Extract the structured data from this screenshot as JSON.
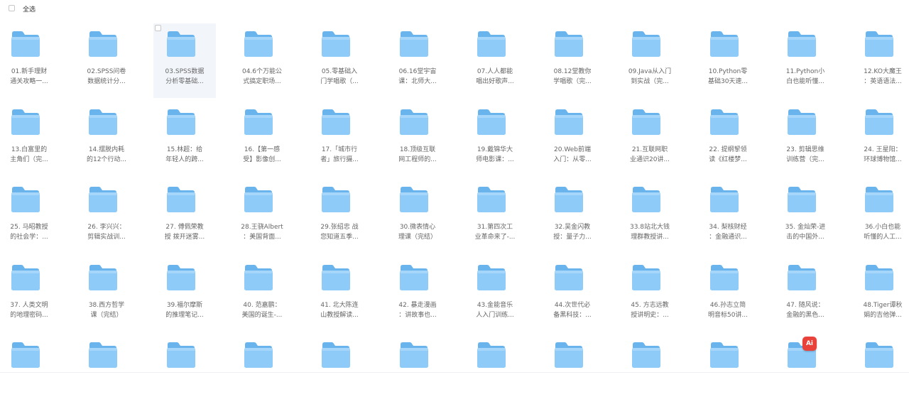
{
  "header": {
    "select_all_label": "全选"
  },
  "accent_color": "#7cc0f5",
  "ai_badge": {
    "icon": "ai-icon",
    "text": "Ai",
    "color": "#e8423a"
  },
  "folders": [
    {
      "name": "01.新手理财通关攻略一...",
      "line1": "01.新手理财",
      "line2": "通关攻略一..."
    },
    {
      "name": "02.SPSS问卷数据统计分...",
      "line1": "02.SPSS问卷",
      "line2": "数据统计分..."
    },
    {
      "name": "03.SPSS数据分析零基础...",
      "line1": "03.SPSS数据",
      "line2": "分析零基础..."
    },
    {
      "name": "04.6个万能公式搞定职场...",
      "line1": "04.6个万能公",
      "line2": "式搞定职场..."
    },
    {
      "name": "05.零基础入门学唱歌（...",
      "line1": "05.零基础入",
      "line2": "门学唱歌（..."
    },
    {
      "name": "06.16堂宇宙课：北师大...",
      "line1": "06.16堂宇宙",
      "line2": "课：北师大..."
    },
    {
      "name": "07.人人都能唱出好歌声...",
      "line1": "07.人人都能",
      "line2": "唱出好歌声..."
    },
    {
      "name": "08.12堂教你学唱歌（完...",
      "line1": "08.12堂教你",
      "line2": "学唱歌（完..."
    },
    {
      "name": "09.Java从入门到实战（完...",
      "line1": "09.Java从入门",
      "line2": "到实战（完..."
    },
    {
      "name": "10.Python零基础30天速...",
      "line1": "10.Python零",
      "line2": "基础30天速..."
    },
    {
      "name": "11.Python小白也能听懂...",
      "line1": "11.Python小",
      "line2": "白也能听懂..."
    },
    {
      "name": "12.KO大魔王：英语语法...",
      "line1": "12.KO大魔王",
      "line2": "：英语语法..."
    },
    {
      "name": "13.白富里的主角们（完...",
      "line1": "13.白富里的",
      "line2": "主角们（完..."
    },
    {
      "name": "14.摆脱内耗的12个行动...",
      "line1": "14.摆脱内耗",
      "line2": "的12个行动..."
    },
    {
      "name": "15.林超：给年轻人的跨...",
      "line1": "15.林超：给",
      "line2": "年轻人的跨..."
    },
    {
      "name": "16.【第一感受】影像创...",
      "line1": "16.【第一感",
      "line2": "受】影像创..."
    },
    {
      "name": "17.「城市行者」旅行摄...",
      "line1": "17.「城市行",
      "line2": "者」旅行摄..."
    },
    {
      "name": "18.顶级互联网工程师的...",
      "line1": "18.顶级互联",
      "line2": "网工程师的..."
    },
    {
      "name": "19.戴锦华大师电影课：...",
      "line1": "19.戴锦华大",
      "line2": "师电影课：..."
    },
    {
      "name": "20.Web前端入门：从零...",
      "line1": "20.Web前端",
      "line2": "入门：从零..."
    },
    {
      "name": "21.互联网职业通识20讲...",
      "line1": "21.互联网职",
      "line2": "业通识20讲..."
    },
    {
      "name": "22.提纲挈领读《红楼梦...",
      "line1": "22. 提纲挈领",
      "line2": "读《红楼梦..."
    },
    {
      "name": "23.剪辑思维训练营（完...",
      "line1": "23. 剪辑思维",
      "line2": "训练营（完..."
    },
    {
      "name": "24.王星阳：环球博物馆...",
      "line1": "24. 王星阳：",
      "line2": "环球博物馆..."
    },
    {
      "name": "25.马昭教授的社会学：...",
      "line1": "25. 马昭教授",
      "line2": "的社会学：..."
    },
    {
      "name": "26.李兴兴：剪辑实战训...",
      "line1": "26. 李兴兴：",
      "line2": "剪辑实战训..."
    },
    {
      "name": "27.傅佩荣教授 拨开迷雾...",
      "line1": "27. 傅佩荣教",
      "line2": "授 拨开迷雾..."
    },
    {
      "name": "28.王骁Albert：美国背面...",
      "line1": "28.王骁Albert",
      "line2": "：美国背面..."
    },
    {
      "name": "29.张绍忠 战您知道五季...",
      "line1": "29.张绍忠 战",
      "line2": "您知道五季..."
    },
    {
      "name": "30.微表情心理课（完结）",
      "line1": "30.微表情心",
      "line2": "理课（完结）"
    },
    {
      "name": "31.第四次工业革命来了-...",
      "line1": "31.第四次工",
      "line2": "业革命来了-..."
    },
    {
      "name": "32.吴金闪教授：量子力...",
      "line1": "32.吴金闪教",
      "line2": "授：量子力..."
    },
    {
      "name": "33.8站北大钱理群教授讲...",
      "line1": "33.8站北大钱",
      "line2": "理群教授讲..."
    },
    {
      "name": "34.梨核财经：金融通识...",
      "line1": "34. 梨核财经",
      "line2": "：金融通识..."
    },
    {
      "name": "35.金灿荣-进击的中国外...",
      "line1": "35. 金灿荣-进",
      "line2": "击的中国外..."
    },
    {
      "name": "36.小白也能听懂的人工...",
      "line1": "36.小白也能",
      "line2": "听懂的人工..."
    },
    {
      "name": "37.人类文明的地理密码...",
      "line1": "37. 人类文明",
      "line2": "的地理密码..."
    },
    {
      "name": "38.西方哲学课（完结）",
      "line1": "38.西方哲学",
      "line2": "课（完结）"
    },
    {
      "name": "39.福尔摩斯的推理笔记...",
      "line1": "39.福尔摩斯",
      "line2": "的推理笔记..."
    },
    {
      "name": "40.范嘉鹏：美国的诞生-...",
      "line1": "40. 范嘉鹏：",
      "line2": "美国的诞生-..."
    },
    {
      "name": "41.北大陈连山教授解读...",
      "line1": "41. 北大陈连",
      "line2": "山教授解读..."
    },
    {
      "name": "42.暴走漫画：讲故事也...",
      "line1": "42. 暴走漫画",
      "line2": "：讲故事也..."
    },
    {
      "name": "43.金能音乐人入门训练...",
      "line1": "43.金能音乐",
      "line2": "人入门训练..."
    },
    {
      "name": "44.次世代必备黑科技：...",
      "line1": "44.次世代必",
      "line2": "备黑科技：..."
    },
    {
      "name": "45.方志远教授讲明史：...",
      "line1": "45. 方志远教",
      "line2": "授讲明史：..."
    },
    {
      "name": "46.孙志立简明音标50讲...",
      "line1": "46.孙志立简",
      "line2": "明音标50讲..."
    },
    {
      "name": "47.随风说：金融的黑色...",
      "line1": "47. 随风说：",
      "line2": "金融的黑色..."
    },
    {
      "name": "48.Tiger谭秋娟的吉他弹...",
      "line1": "48.Tiger谭秋",
      "line2": "娟的吉他弹..."
    },
    {
      "name": "",
      "line1": "",
      "line2": ""
    },
    {
      "name": "",
      "line1": "",
      "line2": ""
    },
    {
      "name": "",
      "line1": "",
      "line2": ""
    },
    {
      "name": "",
      "line1": "",
      "line2": ""
    },
    {
      "name": "",
      "line1": "",
      "line2": ""
    },
    {
      "name": "",
      "line1": "",
      "line2": ""
    },
    {
      "name": "",
      "line1": "",
      "line2": ""
    },
    {
      "name": "",
      "line1": "",
      "line2": ""
    },
    {
      "name": "",
      "line1": "",
      "line2": ""
    },
    {
      "name": "",
      "line1": "",
      "line2": ""
    },
    {
      "name": "",
      "line1": "",
      "line2": ""
    },
    {
      "name": "",
      "line1": "",
      "line2": ""
    }
  ]
}
